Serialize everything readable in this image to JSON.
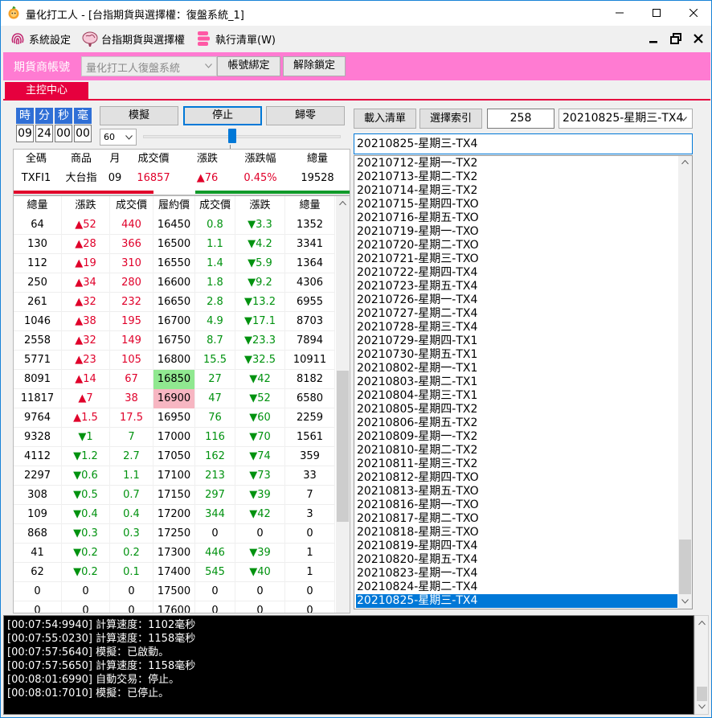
{
  "window": {
    "title": "量化打工人 - [台指期貨與選擇權：復盤系統_1]"
  },
  "menu": {
    "items": [
      {
        "label": "系統設定",
        "icon": "fingerprint-icon"
      },
      {
        "label": "台指期貨與選擇權",
        "icon": "brain-icon"
      },
      {
        "label": "執行清單(W)",
        "icon": "list-icon"
      }
    ]
  },
  "account": {
    "label": "期貨商帳號",
    "selected": "量化打工人復盤系統",
    "bind_button": "帳號綁定",
    "unlock_button": "解除鎖定"
  },
  "tabs": [
    {
      "label": "主控中心",
      "active": true
    }
  ],
  "time": {
    "headers": [
      "時",
      "分",
      "秒",
      "毫"
    ],
    "values": [
      "09",
      "24",
      "00",
      "00"
    ]
  },
  "controls": {
    "simulate": "模擬",
    "stop": "停止",
    "reset": "歸零",
    "speed": "60",
    "slider_value_fraction": 0.45
  },
  "quote": {
    "headers": [
      "全碼",
      "商品",
      "月",
      "成交價",
      "漲跌",
      "漲跌幅",
      "總量"
    ],
    "row": [
      "TXFI1",
      "大台指",
      "09",
      "16857",
      "▲76",
      "0.45%",
      "19528"
    ]
  },
  "ladder": {
    "headers": [
      "總量",
      "漲跌",
      "成交價",
      "履約價",
      "成交價",
      "漲跌",
      "總量"
    ],
    "rows": [
      [
        "64",
        "▲52",
        "440",
        "16450",
        "0.8",
        "▼3.3",
        "1352"
      ],
      [
        "130",
        "▲28",
        "366",
        "16500",
        "1.1",
        "▼4.2",
        "3341"
      ],
      [
        "112",
        "▲19",
        "310",
        "16550",
        "1.4",
        "▼5.9",
        "1364"
      ],
      [
        "250",
        "▲34",
        "280",
        "16600",
        "1.8",
        "▼9.2",
        "4306"
      ],
      [
        "261",
        "▲32",
        "232",
        "16650",
        "2.8",
        "▼13.2",
        "6955"
      ],
      [
        "1046",
        "▲38",
        "195",
        "16700",
        "4.9",
        "▼17.1",
        "8703"
      ],
      [
        "2558",
        "▲32",
        "149",
        "16750",
        "8.7",
        "▼23.3",
        "7894"
      ],
      [
        "5771",
        "▲23",
        "105",
        "16800",
        "15.5",
        "▼32.5",
        "10911"
      ],
      [
        "8091",
        "▲14",
        "67",
        "16850",
        "27",
        "▼42",
        "8182"
      ],
      [
        "11817",
        "▲7",
        "38",
        "16900",
        "47",
        "▼52",
        "6580"
      ],
      [
        "9764",
        "▲1.5",
        "17.5",
        "16950",
        "76",
        "▼60",
        "2259"
      ],
      [
        "9328",
        "▼1",
        "7",
        "17000",
        "116",
        "▼70",
        "1561"
      ],
      [
        "4112",
        "▼1.2",
        "2.7",
        "17050",
        "162",
        "▼74",
        "359"
      ],
      [
        "2297",
        "▼0.6",
        "1.1",
        "17100",
        "213",
        "▼73",
        "33"
      ],
      [
        "308",
        "▼0.5",
        "0.7",
        "17150",
        "297",
        "▼39",
        "7"
      ],
      [
        "109",
        "▼0.4",
        "0.4",
        "17200",
        "344",
        "▼42",
        "3"
      ],
      [
        "868",
        "▼0.3",
        "0.3",
        "17250",
        "0",
        "0",
        "0"
      ],
      [
        "41",
        "▼0.2",
        "0.2",
        "17300",
        "446",
        "▼39",
        "1"
      ],
      [
        "62",
        "▼0.2",
        "0.1",
        "17400",
        "545",
        "▼40",
        "1"
      ],
      [
        "0",
        "0",
        "0",
        "17500",
        "0",
        "0",
        "0"
      ],
      [
        "0",
        "0",
        "0",
        "17600",
        "0",
        "0",
        "0"
      ]
    ],
    "highlight": {
      "call_strike": "16850",
      "put_strike": "16900"
    }
  },
  "right": {
    "load_button": "載入清單",
    "select_index_button": "選擇索引",
    "index_value": "258",
    "selected_option": "20210825-星期三-TX4",
    "current_value": "20210825-星期三-TX4",
    "list": [
      "20210712-星期一-TX2",
      "20210713-星期二-TX2",
      "20210714-星期三-TX2",
      "20210715-星期四-TXO",
      "20210716-星期五-TXO",
      "20210719-星期一-TXO",
      "20210720-星期二-TXO",
      "20210721-星期三-TXO",
      "20210722-星期四-TX4",
      "20210723-星期五-TX4",
      "20210726-星期一-TX4",
      "20210727-星期二-TX4",
      "20210728-星期三-TX4",
      "20210729-星期四-TX1",
      "20210730-星期五-TX1",
      "20210802-星期一-TX1",
      "20210803-星期二-TX1",
      "20210804-星期三-TX1",
      "20210805-星期四-TX2",
      "20210806-星期五-TX2",
      "20210809-星期一-TX2",
      "20210810-星期二-TX2",
      "20210811-星期三-TX2",
      "20210812-星期四-TXO",
      "20210813-星期五-TXO",
      "20210816-星期一-TXO",
      "20210817-星期二-TXO",
      "20210818-星期三-TXO",
      "20210819-星期四-TX4",
      "20210820-星期五-TX4",
      "20210823-星期一-TX4",
      "20210824-星期二-TX4",
      "20210825-星期三-TX4"
    ],
    "selected_index": 32
  },
  "log": [
    "[00:07:54:9940] 計算速度：1102毫秒",
    "[00:07:55:0230] 計算速度：1158毫秒",
    "[00:07:57:5640] 模擬：已啟動。",
    "[00:07:57:5650] 計算速度：1158毫秒",
    "[00:08:01:6990] 自動交易：停止。",
    "[00:08:01:7010] 模擬：已停止。"
  ],
  "colors": {
    "accent_pink": "#ff7bd2",
    "tab_red": "#e6003e",
    "up_red": "#e0002a",
    "down_green": "#00920f",
    "call_highlight": "#90e890",
    "put_highlight": "#f7b6c2",
    "selection_blue": "#0078d7"
  }
}
